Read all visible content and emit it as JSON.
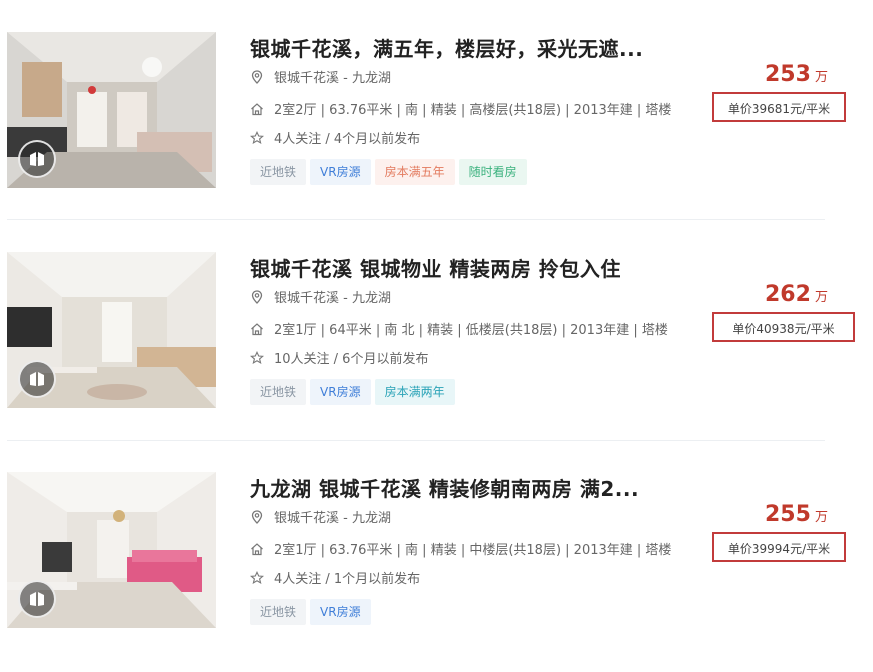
{
  "colors": {
    "price": "#c0392b",
    "highlight_border": "#c23b3b"
  },
  "listings": [
    {
      "title": "银城千花溪，满五年，楼层好，采光无遮...",
      "location": "银城千花溪 - 九龙湖",
      "details": "2室2厅 | 63.76平米 | 南 | 精装 | 高楼层(共18层) | 2013年建 | 塔楼",
      "followers": "4人关注 / 4个月以前发布",
      "tags": [
        "近地铁",
        "VR房源",
        "房本满五年",
        "随时看房"
      ],
      "price": "253",
      "price_unit": "万",
      "unit_price": "单价39681元/平米"
    },
    {
      "title": "银城千花溪 银城物业 精装两房 拎包入住",
      "location": "银城千花溪 - 九龙湖",
      "details": "2室1厅 | 64平米 | 南 北 | 精装 | 低楼层(共18层) | 2013年建 | 塔楼",
      "followers": "10人关注 / 6个月以前发布",
      "tags": [
        "近地铁",
        "VR房源",
        "房本满两年"
      ],
      "price": "262",
      "price_unit": "万",
      "unit_price": "单价40938元/平米"
    },
    {
      "title": "九龙湖 银城千花溪 精装修朝南两房 满2...",
      "location": "银城千花溪 - 九龙湖",
      "details": "2室1厅 | 63.76平米 | 南 | 精装 | 中楼层(共18层) | 2013年建 | 塔楼",
      "followers": "4人关注 / 1个月以前发布",
      "tags": [
        "近地铁",
        "VR房源"
      ],
      "price": "255",
      "price_unit": "万",
      "unit_price": "单价39994元/平米"
    }
  ]
}
